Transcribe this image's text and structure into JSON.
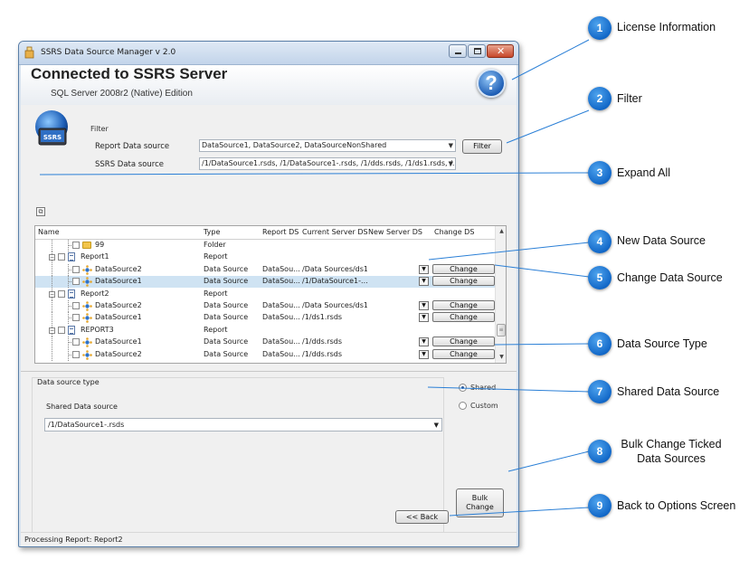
{
  "window": {
    "title": "SSRS Data Source Manager v 2.0",
    "heading": "Connected to SSRS Server",
    "edition": "SQL Server 2008r2 (Native)  Edition",
    "help_glyph": "?",
    "logo_text": "SSRS"
  },
  "filter": {
    "label": "Filter",
    "report_ds_label": "Report Data source",
    "report_ds_value": "DataSource1, DataSource2, DataSourceNonShared",
    "ssrs_ds_label": "SSRS Data source",
    "ssrs_ds_value": "/1/DataSource1.rsds, /1/DataSource1-.rsds, /1/dds.rsds, /1/ds1.rsds, /...",
    "filter_button": "Filter"
  },
  "grid": {
    "columns": [
      "Name",
      "Type",
      "Report DS",
      "Current Server DS",
      "New Server DS",
      "Change DS"
    ],
    "rows": [
      {
        "name": "99",
        "type": "Folder",
        "report_ds": "",
        "current": "",
        "has_change": false
      },
      {
        "name": "Report1",
        "type": "Report",
        "report_ds": "",
        "current": "",
        "has_change": false
      },
      {
        "name": "DataSource2",
        "type": "Data Source",
        "report_ds": "DataSou...",
        "current": "/Data Sources/ds1",
        "has_change": true,
        "change": "Change"
      },
      {
        "name": "DataSource1",
        "type": "Data Source",
        "report_ds": "DataSou...",
        "current": "/1/DataSource1-...",
        "has_change": true,
        "change": "Change"
      },
      {
        "name": "Report2",
        "type": "Report",
        "report_ds": "",
        "current": "",
        "has_change": false
      },
      {
        "name": "DataSource2",
        "type": "Data Source",
        "report_ds": "DataSou...",
        "current": "/Data Sources/ds1",
        "has_change": true,
        "change": "Change"
      },
      {
        "name": "DataSource1",
        "type": "Data Source",
        "report_ds": "DataSou...",
        "current": "/1/ds1.rsds",
        "has_change": true,
        "change": "Change"
      },
      {
        "name": "REPORT3",
        "type": "Report",
        "report_ds": "",
        "current": "",
        "has_change": false
      },
      {
        "name": "DataSource1",
        "type": "Data Source",
        "report_ds": "DataSou...",
        "current": "/1/dds.rsds",
        "has_change": true,
        "change": "Change"
      },
      {
        "name": "DataSource2",
        "type": "Data Source",
        "report_ds": "DataSou...",
        "current": "/1/dds.rsds",
        "has_change": true,
        "change": "Change"
      }
    ],
    "selected_row": 3
  },
  "dstype": {
    "label": "Data source type",
    "shared_ds_label": "Shared Data source",
    "shared_ds_value": "/1/DataSource1-.rsds",
    "radio_shared": "Shared",
    "radio_custom": "Custom",
    "selected": "Shared"
  },
  "buttons": {
    "bulk_line1": "Bulk",
    "bulk_line2": "Change",
    "back": "<< Back"
  },
  "status": "Processing Report: Report2",
  "callouts": [
    {
      "num": "1",
      "text": "License Information"
    },
    {
      "num": "2",
      "text": "Filter"
    },
    {
      "num": "3",
      "text": "Expand All"
    },
    {
      "num": "4",
      "text": "New Data Source"
    },
    {
      "num": "5",
      "text": "Change Data Source"
    },
    {
      "num": "6",
      "text": "Data Source Type"
    },
    {
      "num": "7",
      "text": "Shared Data Source"
    },
    {
      "num": "8",
      "text_line1": "Bulk Change Ticked",
      "text_line2": "Data Sources"
    },
    {
      "num": "9",
      "text": "Back to Options Screen"
    }
  ]
}
